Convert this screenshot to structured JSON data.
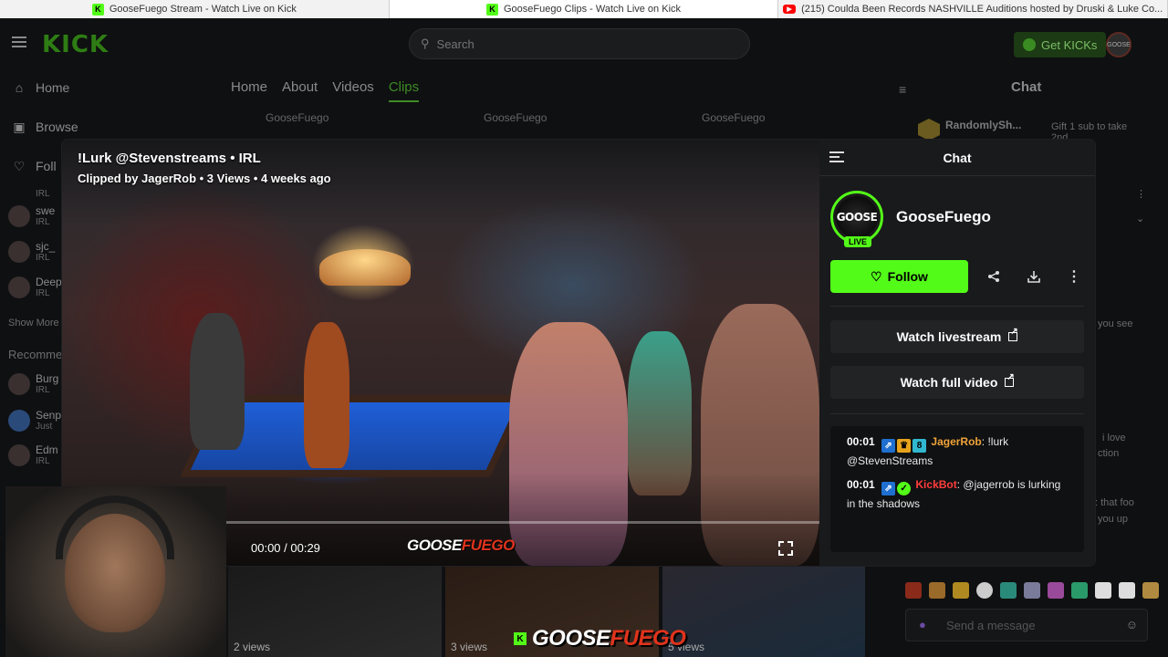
{
  "browser": {
    "tabs": [
      {
        "title": "GooseFuego Stream - Watch Live on Kick",
        "icon": "kick-favicon"
      },
      {
        "title": "GooseFuego Clips - Watch Live on Kick",
        "icon": "kick-favicon"
      },
      {
        "title": "(215) Coulda Been Records NASHVILLE Auditions hosted by Druski & Luke Co...",
        "icon": "youtube-favicon"
      }
    ]
  },
  "header": {
    "logo": "KICK",
    "search_placeholder": "Search",
    "get_kicks": "Get KICKs",
    "avatar_text": "GOOSE"
  },
  "sidebar": {
    "home": "Home",
    "browse": "Browse",
    "following": "Foll",
    "channels": [
      {
        "name": "",
        "sub": "IRL"
      },
      {
        "name": "swe",
        "sub": "IRL"
      },
      {
        "name": "sjc_",
        "sub": "IRL"
      },
      {
        "name": "Deep",
        "sub": "IRL"
      }
    ],
    "show_more": "Show More",
    "recommended": "Recomme",
    "recommended_channels": [
      {
        "name": "Burg",
        "sub": "IRL"
      },
      {
        "name": "Senp",
        "sub": "Just"
      },
      {
        "name": "Edm",
        "sub": "IRL"
      }
    ]
  },
  "page_tabs": [
    "Home",
    "About",
    "Videos",
    "Clips"
  ],
  "clip_owners": [
    "GooseFuego",
    "GooseFuego",
    "GooseFuego"
  ],
  "thumb_views": [
    "2 views",
    "3 views",
    "5 views"
  ],
  "right_chat": {
    "title": "Chat",
    "gifter": "RandomlySh...",
    "gift_text": "Gift 1 sub to take 2nd",
    "snippets": [
      "you see",
      "i love",
      "ction",
      ": that foo",
      "you up"
    ],
    "send_placeholder": "Send a message"
  },
  "modal": {
    "clip_title": "!Lurk @Stevenstreams • IRL",
    "clip_meta": "Clipped by JagerRob • 3 Views • 4 weeks ago",
    "time": "00:00 / 00:29",
    "watermark_a": "GOOSE",
    "watermark_b": "FUEGO",
    "progress_percent": 0,
    "side_title": "Chat",
    "channel_name": "GooseFuego",
    "avatar_text": "GOOSE",
    "live_badge": "LIVE",
    "follow_label": "Follow",
    "watch_livestream": "Watch livestream",
    "watch_full_video": "Watch full video",
    "messages": [
      {
        "time": "00:01",
        "user": "JagerRob",
        "sep": ":",
        "text": "!lurk @StevenStreams",
        "color": "#f0a33a"
      },
      {
        "time": "00:01",
        "user": "KickBot",
        "sep": ":",
        "text": "@jagerrob is lurking in the shadows",
        "color": "#ff3c3c"
      }
    ]
  },
  "bottom_watermark": {
    "a": "GOOSE",
    "b": "FUEGO"
  },
  "colors": {
    "kick_green": "#53fc18",
    "watermark_red": "#e0331c"
  }
}
